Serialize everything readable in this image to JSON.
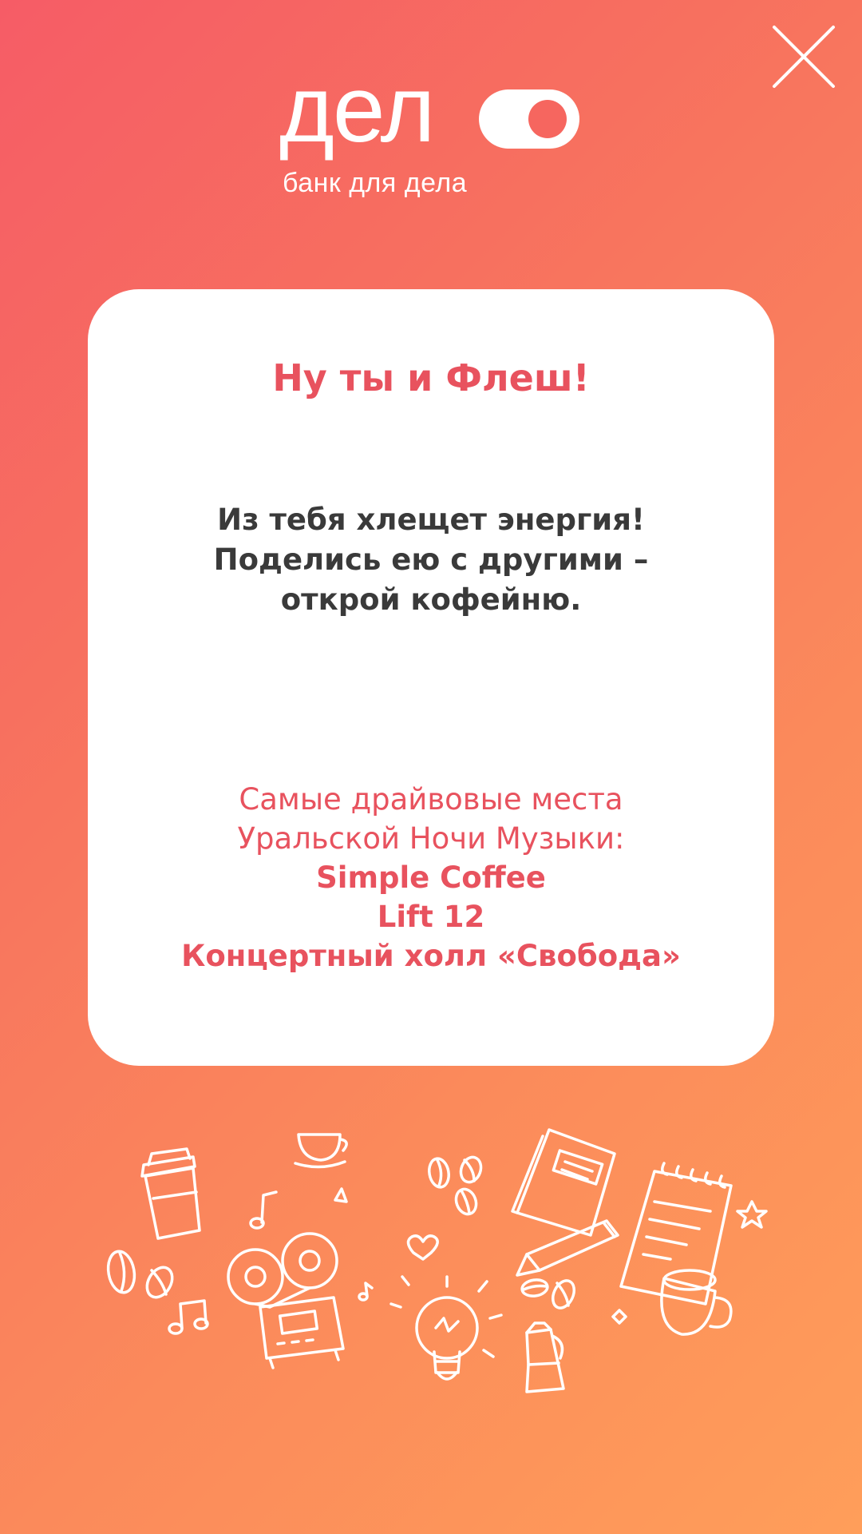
{
  "header": {
    "brand_word": "дел",
    "tagline": "банк для дела"
  },
  "card": {
    "title": "Ну ты и Флеш!",
    "body_lines": [
      "Из тебя хлещет энергия!",
      "Поделись ею с другими –",
      "открой кофейню."
    ],
    "places_intro_lines": [
      "Самые драйвовые места",
      "Уральской Ночи Музыки:"
    ],
    "places": [
      "Simple Coffee",
      "Lift 12",
      "Концертный холл «Свобода»"
    ]
  },
  "colors": {
    "gradient_start": "#f65c66",
    "gradient_end": "#ff9e5a",
    "accent_red": "#e8525e",
    "text_dark": "#3a3a3a",
    "card_bg": "#ffffff"
  },
  "icons": {
    "close": "close-icon",
    "illustration": "coffee-music-doodles"
  }
}
